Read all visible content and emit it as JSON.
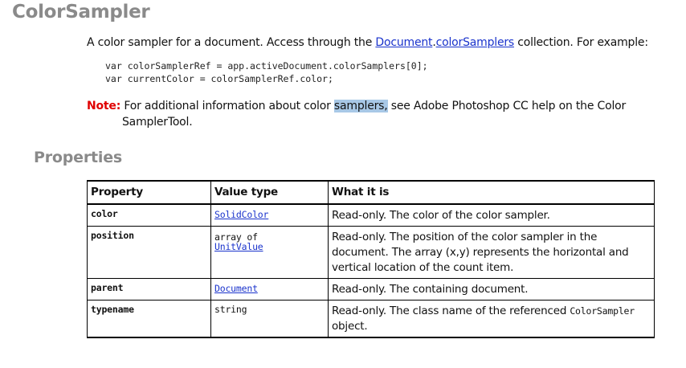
{
  "title": "ColorSampler",
  "intro": {
    "before": "A color sampler for a document. Access through the ",
    "link1": "Document",
    "dot": ".",
    "link2": "colorSamplers",
    "after": " collection. For example:"
  },
  "code_lines": [
    "var colorSamplerRef = app.activeDocument.colorSamplers[0];",
    "var currentColor = colorSamplerRef.color;"
  ],
  "note": {
    "label": "Note:",
    "text_before": " For additional information about color ",
    "highlighted": "samplers,",
    "text_after": " see Adobe Photoshop CC help on the Color",
    "line2": "SamplerTool."
  },
  "section_title": "Properties",
  "table": {
    "headers": [
      "Property",
      "Value type",
      "What it is"
    ],
    "rows": [
      {
        "property": "color",
        "type_prefix": "",
        "type_link": "SolidColor",
        "type_plain": "",
        "desc": "Read-only. The color of the color sampler.",
        "desc_code": "",
        "desc_tail": ""
      },
      {
        "property": "position",
        "type_prefix": "array of",
        "type_link": "UnitValue",
        "type_plain": "",
        "desc": "Read-only. The position of the color sampler in the document. The array (x,y) represents the horizontal and vertical location of the count item.",
        "desc_code": "",
        "desc_tail": ""
      },
      {
        "property": "parent",
        "type_prefix": "",
        "type_link": "Document",
        "type_plain": "",
        "desc": "Read-only. The containing document.",
        "desc_code": "",
        "desc_tail": ""
      },
      {
        "property": "typename",
        "type_prefix": "",
        "type_link": "",
        "type_plain": "string",
        "desc": "Read-only. The class name of the referenced ",
        "desc_code": "ColorSampler",
        "desc_tail": " object."
      }
    ]
  }
}
